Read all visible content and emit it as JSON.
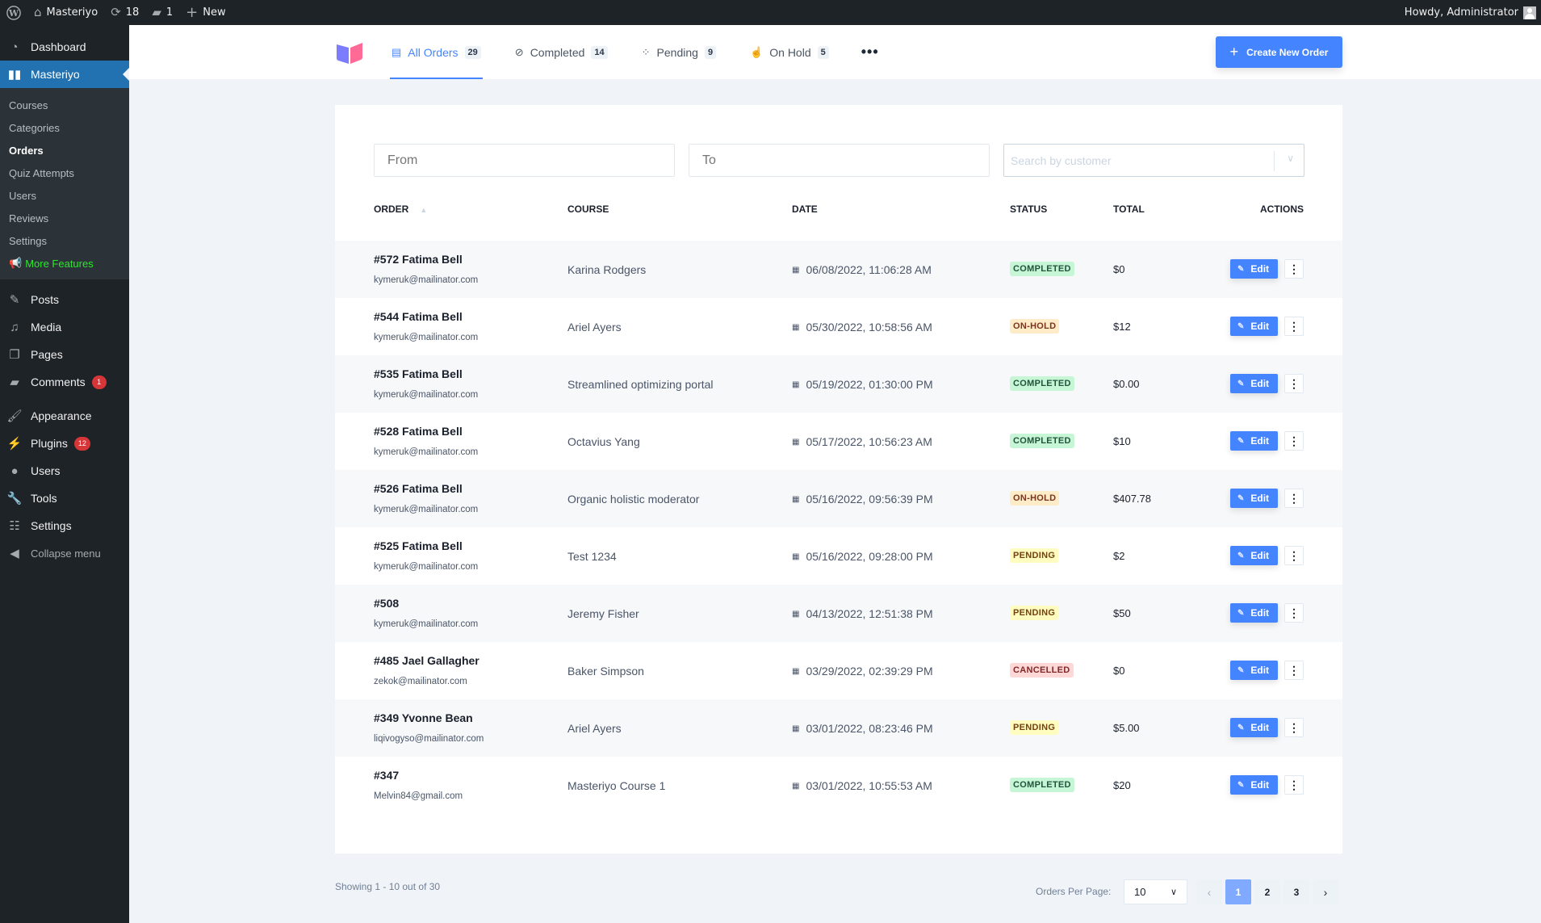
{
  "adminbar": {
    "site_name": "Masteriyo",
    "updates_count": "18",
    "comments_count": "1",
    "new_label": "New",
    "greeting": "Howdy, Administrator"
  },
  "sidebar": {
    "dashboard": "Dashboard",
    "masteriyo": "Masteriyo",
    "submenu": [
      {
        "label": "Courses"
      },
      {
        "label": "Categories"
      },
      {
        "label": "Orders"
      },
      {
        "label": "Quiz Attempts"
      },
      {
        "label": "Users"
      },
      {
        "label": "Reviews"
      },
      {
        "label": "Settings"
      },
      {
        "label": "More Features"
      }
    ],
    "items": [
      {
        "label": "Posts"
      },
      {
        "label": "Media"
      },
      {
        "label": "Pages"
      },
      {
        "label": "Comments",
        "badge": "1"
      },
      {
        "label": "Appearance"
      },
      {
        "label": "Plugins",
        "badge": "12"
      },
      {
        "label": "Users"
      },
      {
        "label": "Tools"
      },
      {
        "label": "Settings"
      }
    ],
    "collapse": "Collapse menu"
  },
  "header": {
    "tabs": [
      {
        "label": "All Orders",
        "count": "29",
        "active": true
      },
      {
        "label": "Completed",
        "count": "14"
      },
      {
        "label": "Pending",
        "count": "9"
      },
      {
        "label": "On Hold",
        "count": "5"
      }
    ],
    "more": "•••",
    "create_button": "Create New Order"
  },
  "filters": {
    "from_placeholder": "From",
    "to_placeholder": "To",
    "customer_placeholder": "Search by customer"
  },
  "table": {
    "columns": {
      "order": "ORDER",
      "course": "COURSE",
      "date": "DATE",
      "status": "STATUS",
      "total": "TOTAL",
      "actions": "ACTIONS"
    },
    "edit_label": "Edit",
    "rows": [
      {
        "order": "#572 Fatima Bell",
        "email": "kymeruk@mailinator.com",
        "course": "Karina Rodgers",
        "date": "06/08/2022, 11:06:28 AM",
        "status": "COMPLETED",
        "total": "$0"
      },
      {
        "order": "#544 Fatima Bell",
        "email": "kymeruk@mailinator.com",
        "course": "Ariel Ayers",
        "date": "05/30/2022, 10:58:56 AM",
        "status": "ON-HOLD",
        "total": "$12"
      },
      {
        "order": "#535 Fatima Bell",
        "email": "kymeruk@mailinator.com",
        "course": "Streamlined optimizing portal",
        "date": "05/19/2022, 01:30:00 PM",
        "status": "COMPLETED",
        "total": "$0.00"
      },
      {
        "order": "#528 Fatima Bell",
        "email": "kymeruk@mailinator.com",
        "course": "Octavius Yang",
        "date": "05/17/2022, 10:56:23 AM",
        "status": "COMPLETED",
        "total": "$10"
      },
      {
        "order": "#526 Fatima Bell",
        "email": "kymeruk@mailinator.com",
        "course": "Organic holistic moderator",
        "date": "05/16/2022, 09:56:39 PM",
        "status": "ON-HOLD",
        "total": "$407.78"
      },
      {
        "order": "#525 Fatima Bell",
        "email": "kymeruk@mailinator.com",
        "course": "Test 1234",
        "date": "05/16/2022, 09:28:00 PM",
        "status": "PENDING",
        "total": "$2"
      },
      {
        "order": "#508",
        "email": "kymeruk@mailinator.com",
        "course": "Jeremy Fisher",
        "date": "04/13/2022, 12:51:38 PM",
        "status": "PENDING",
        "total": "$50"
      },
      {
        "order": "#485 Jael Gallagher",
        "email": "zekok@mailinator.com",
        "course": "Baker Simpson",
        "date": "03/29/2022, 02:39:29 PM",
        "status": "CANCELLED",
        "total": "$0"
      },
      {
        "order": "#349 Yvonne Bean",
        "email": "liqivogyso@mailinator.com",
        "course": "Ariel Ayers",
        "date": "03/01/2022, 08:23:46 PM",
        "status": "PENDING",
        "total": "$5.00"
      },
      {
        "order": "#347",
        "email": "Melvin84@gmail.com",
        "course": "Masteriyo Course 1",
        "date": "03/01/2022, 10:55:53 AM",
        "status": "COMPLETED",
        "total": "$20"
      }
    ]
  },
  "footer": {
    "showing": "Showing 1 - 10 out of 30",
    "per_page_label": "Orders Per Page:",
    "per_page_value": "10",
    "pages": [
      "1",
      "2",
      "3"
    ],
    "current_page": "1"
  },
  "colors": {
    "accent": "#4584ff",
    "wp_admin_active": "#2271b1",
    "more_features": "#2ee62e"
  }
}
